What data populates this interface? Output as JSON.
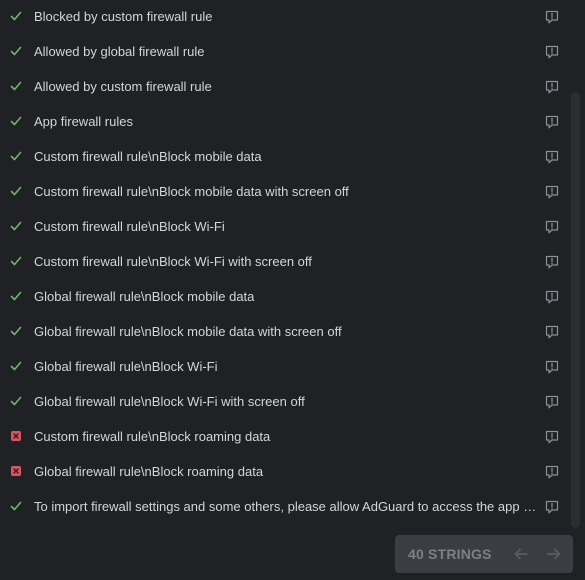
{
  "rows": [
    {
      "status": "translated",
      "status_icon": "check-icon",
      "label": "Blocked by custom firewall rule"
    },
    {
      "status": "translated",
      "status_icon": "check-icon",
      "label": "Allowed by global firewall rule"
    },
    {
      "status": "translated",
      "status_icon": "check-icon",
      "label": "Allowed by custom firewall rule"
    },
    {
      "status": "translated",
      "status_icon": "check-icon",
      "label": "App firewall rules"
    },
    {
      "status": "translated",
      "status_icon": "check-icon",
      "label": "Custom firewall rule\\nBlock mobile data"
    },
    {
      "status": "translated",
      "status_icon": "check-icon",
      "label": "Custom firewall rule\\nBlock mobile data with screen off"
    },
    {
      "status": "translated",
      "status_icon": "check-icon",
      "label": "Custom firewall rule\\nBlock Wi-Fi"
    },
    {
      "status": "translated",
      "status_icon": "check-icon",
      "label": "Custom firewall rule\\nBlock Wi-Fi with screen off"
    },
    {
      "status": "translated",
      "status_icon": "check-icon",
      "label": "Global firewall rule\\nBlock mobile data"
    },
    {
      "status": "translated",
      "status_icon": "check-icon",
      "label": "Global firewall rule\\nBlock mobile data with screen off"
    },
    {
      "status": "translated",
      "status_icon": "check-icon",
      "label": "Global firewall rule\\nBlock Wi-Fi"
    },
    {
      "status": "translated",
      "status_icon": "check-icon",
      "label": "Global firewall rule\\nBlock Wi-Fi with screen off"
    },
    {
      "status": "untranslated",
      "status_icon": "untranslated-square-icon",
      "label": "Custom firewall rule\\nBlock roaming data"
    },
    {
      "status": "untranslated",
      "status_icon": "untranslated-square-icon",
      "label": "Global firewall rule\\nBlock roaming data"
    },
    {
      "status": "translated",
      "status_icon": "check-icon",
      "label": "To import firewall settings and some others, please allow AdGuard to access the app usage data"
    }
  ],
  "row_comment_icon": "comment-icon",
  "pager": {
    "count_label": "40 STRINGS",
    "prev_icon": "arrow-left-icon",
    "next_icon": "arrow-right-icon"
  },
  "colors": {
    "background": "#1f2125",
    "text": "#d4d5d7",
    "check": "#6db86a",
    "untranslated": "#e2525c",
    "icon": "#8e9096",
    "pager_bg": "#3a3d42",
    "pager_text": "#7d8086"
  }
}
